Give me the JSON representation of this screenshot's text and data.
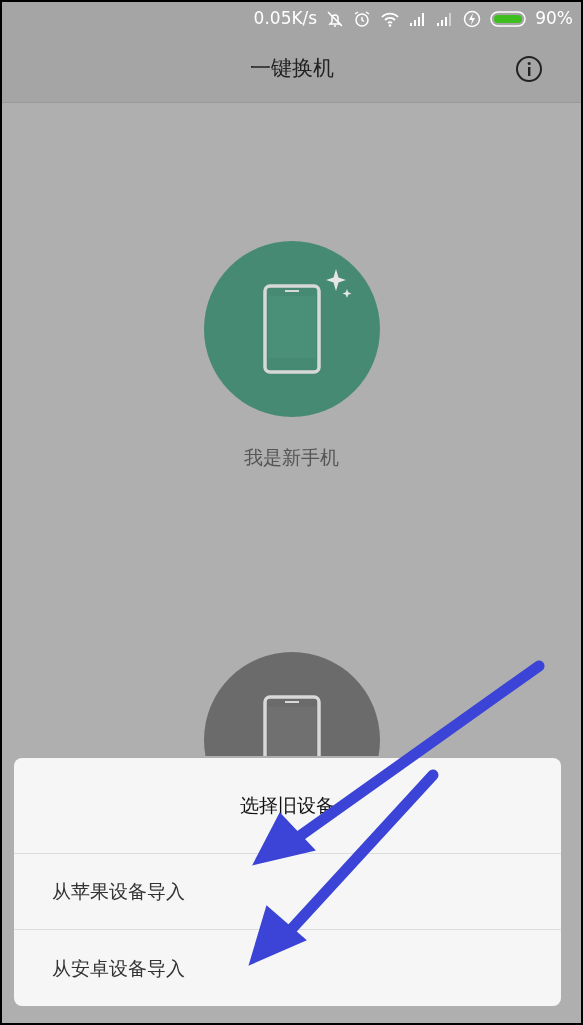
{
  "status_bar": {
    "network_speed": "0.05K/s",
    "battery": "90%"
  },
  "app_bar": {
    "title": "一键换机"
  },
  "roles": [
    {
      "label": "我是新手机",
      "color": "#468a73"
    },
    {
      "color": "#6b6b6b"
    }
  ],
  "dialog": {
    "title": "选择旧设备",
    "options": [
      "从苹果设备导入",
      "从安卓设备导入"
    ]
  }
}
